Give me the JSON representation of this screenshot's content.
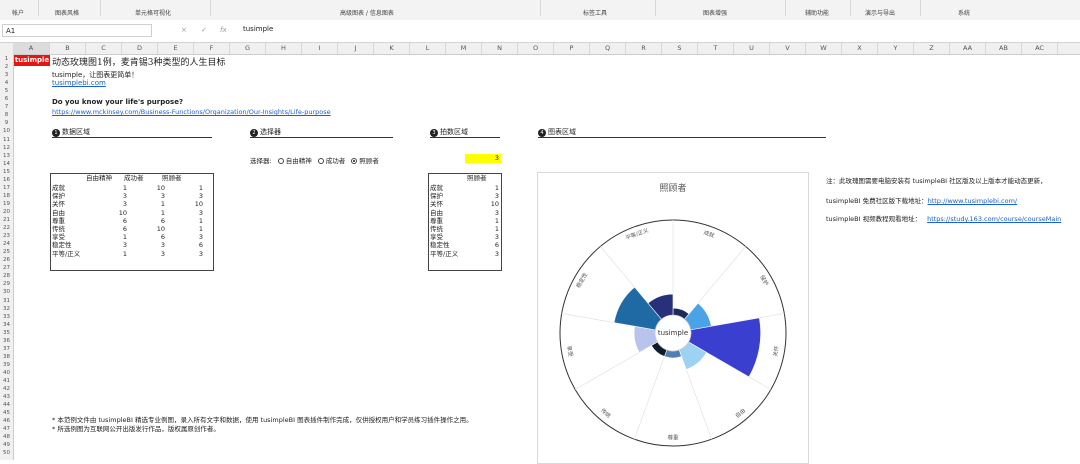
{
  "ribbon": {
    "groups": [
      "帐户",
      "图表风格",
      "单元格可视化",
      "高级图表 / 信息图表",
      "标签工具",
      "图表增强",
      "辅助功能",
      "演示与导出",
      "系统"
    ]
  },
  "formula_bar": {
    "cell_ref": "A1",
    "cancel_icon": "×",
    "confirm_icon": "✓",
    "fx_label": "fx",
    "value": "tusimple"
  },
  "columns": [
    "A",
    "B",
    "C",
    "D",
    "E",
    "F",
    "G",
    "H",
    "I",
    "J",
    "K",
    "L",
    "M",
    "N",
    "O",
    "P",
    "Q",
    "R",
    "S",
    "T",
    "U",
    "V",
    "W",
    "X",
    "Y",
    "Z",
    "AA",
    "AB",
    "AC"
  ],
  "rows": [
    "1",
    "2",
    "3",
    "4",
    "5",
    "6",
    "7",
    "8",
    "9",
    "10",
    "11",
    "12",
    "13",
    "14",
    "15",
    "16",
    "17",
    "18",
    "19",
    "20",
    "21",
    "22",
    "23",
    "24",
    "25",
    "26",
    "27",
    "28",
    "29",
    "30",
    "31",
    "32",
    "33",
    "34",
    "35",
    "36",
    "37",
    "38",
    "39",
    "40",
    "41",
    "42",
    "43",
    "44",
    "45",
    "46",
    "47",
    "48",
    "49",
    "50"
  ],
  "sheet": {
    "a1": "tusimple",
    "title": "动态玫瑰图1例，麦肯锡3种类型的人生目标",
    "subtitle": "tusimple，让图表更简单！",
    "site_link": "tusimplebi.com",
    "question": "Do you know your life's purpose?",
    "mck_link": "https://www.mckinsey.com/Business-Functions/Organization/Our-Insights/Life-purpose",
    "sections": [
      {
        "num": "1",
        "label": "数据区域"
      },
      {
        "num": "2",
        "label": "选择器"
      },
      {
        "num": "3",
        "label": "拍数区域"
      },
      {
        "num": "4",
        "label": "图表区域"
      }
    ],
    "selector": {
      "label": "选择器:",
      "options": [
        "自由精神",
        "成功者",
        "照顾者"
      ],
      "selected": "照顾者"
    },
    "selected_index": "3",
    "data_table": {
      "headers": [
        "自由精神",
        "成功者",
        "照顾者"
      ],
      "rows": [
        {
          "label": "成就",
          "v": [
            "1",
            "10",
            "1"
          ]
        },
        {
          "label": "保护",
          "v": [
            "3",
            "3",
            "3"
          ]
        },
        {
          "label": "关怀",
          "v": [
            "3",
            "1",
            "10"
          ]
        },
        {
          "label": "自由",
          "v": [
            "10",
            "1",
            "3"
          ]
        },
        {
          "label": "尊重",
          "v": [
            "6",
            "6",
            "1"
          ]
        },
        {
          "label": "传统",
          "v": [
            "6",
            "10",
            "1"
          ]
        },
        {
          "label": "享受",
          "v": [
            "1",
            "6",
            "3"
          ]
        },
        {
          "label": "稳定性",
          "v": [
            "3",
            "3",
            "6"
          ]
        },
        {
          "label": "平等/正义",
          "v": [
            "1",
            "3",
            "3"
          ]
        }
      ]
    },
    "extract_table": {
      "header": "照顾者",
      "rows": [
        {
          "label": "成就",
          "v": "1"
        },
        {
          "label": "保护",
          "v": "3"
        },
        {
          "label": "关怀",
          "v": "10"
        },
        {
          "label": "自由",
          "v": "3"
        },
        {
          "label": "尊重",
          "v": "1"
        },
        {
          "label": "传统",
          "v": "1"
        },
        {
          "label": "享受",
          "v": "3"
        },
        {
          "label": "稳定性",
          "v": "6"
        },
        {
          "label": "平等/正义",
          "v": "3"
        }
      ]
    },
    "notes": [
      "注：此玫瑰图需要电脑安装有 tusimpleBI 社区版及以上版本才能动态更新，",
      "tusimpleBI 免费社区版下载地址：",
      "tusimpleBI 视频教程观看地址："
    ],
    "note_links": [
      "http://www.tusimplebi.com/",
      "https://study.163.com/course/courseMain"
    ],
    "footnotes": [
      "* 本范例文件由 tusimpleBI 精选专业例图，录入所有文字和数据，使用 tusimpleBI 图表插件制作完成，仅供授权用户和学员练习插件操作之用。",
      "* 所选例图为互联网公开出版发行作品，版权属原创作者。"
    ]
  },
  "chart_data": {
    "type": "rose",
    "title": "照顾者",
    "center_label": "tusimple",
    "categories": [
      "成就",
      "保护",
      "关怀",
      "自由",
      "尊重",
      "传统",
      "享受",
      "稳定性",
      "平等/正义"
    ],
    "values": [
      1,
      3,
      10,
      3,
      1,
      1,
      3,
      6,
      3
    ],
    "max": 10,
    "colors": [
      "#1e2a5a",
      "#4aa3e6",
      "#3a3fcf",
      "#9dd2f2",
      "#4f7fb3",
      "#0e1b2c",
      "#b8c4ee",
      "#1f6aa5",
      "#27307a"
    ]
  }
}
